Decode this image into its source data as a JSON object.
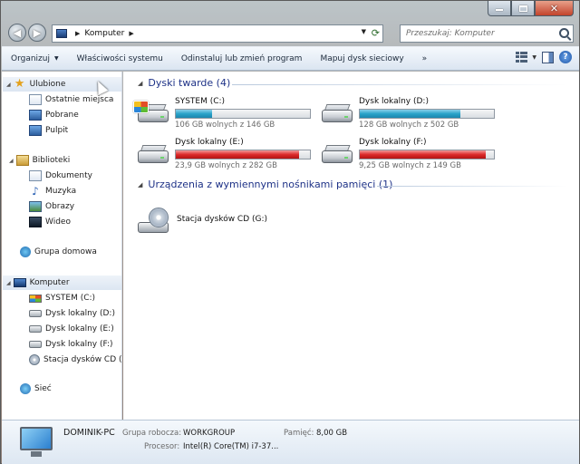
{
  "address": {
    "crumbs": [
      "Komputer"
    ]
  },
  "search": {
    "placeholder": "Przeszukaj: Komputer"
  },
  "toolbar": {
    "organize": "Organizuj",
    "properties": "Właściwości systemu",
    "uninstall": "Odinstaluj lub zmień program",
    "map_drive": "Mapuj dysk sieciowy",
    "more": "»"
  },
  "sidebar": {
    "favorites": {
      "label": "Ulubione",
      "items": [
        "Ostatnie miejsca",
        "Pobrane",
        "Pulpit"
      ]
    },
    "libraries": {
      "label": "Biblioteki",
      "items": [
        "Dokumenty",
        "Muzyka",
        "Obrazy",
        "Wideo"
      ]
    },
    "homegroup": {
      "label": "Grupa domowa"
    },
    "computer": {
      "label": "Komputer",
      "items": [
        "SYSTEM (C:)",
        "Dysk lokalny (D:)",
        "Dysk lokalny (E:)",
        "Dysk lokalny (F:)",
        "Stacja dysków CD (G:)"
      ]
    },
    "network": {
      "label": "Sieć"
    }
  },
  "main": {
    "hard_disks_header": "Dyski twarde (4)",
    "removable_header": "Urządzenia z wymiennymi nośnikami pamięci (1)",
    "drives": [
      {
        "name": "SYSTEM (C:)",
        "free": "106 GB wolnych z 146 GB",
        "used_fraction": 0.27,
        "bar_color": "#2aa3c9"
      },
      {
        "name": "Dysk lokalny (D:)",
        "free": "128 GB wolnych z 502 GB",
        "used_fraction": 0.75,
        "bar_color": "#2aa3c9"
      },
      {
        "name": "Dysk lokalny (E:)",
        "free": "23,9 GB wolnych z 282 GB",
        "used_fraction": 0.92,
        "bar_color": "#dc2a2a"
      },
      {
        "name": "Dysk lokalny (F:)",
        "free": "9,25 GB wolnych z 149 GB",
        "used_fraction": 0.94,
        "bar_color": "#dc2a2a"
      }
    ],
    "cd_drive": {
      "name": "Stacja dysków CD (G:)"
    }
  },
  "details": {
    "pc_name": "DOMINIK-PC",
    "workgroup_label": "Grupa robocza:",
    "workgroup_value": "WORKGROUP",
    "memory_label": "Pamięć:",
    "memory_value": "8,00 GB",
    "processor_label": "Procesor:",
    "processor_value": "Intel(R) Core(TM) i7-37..."
  }
}
